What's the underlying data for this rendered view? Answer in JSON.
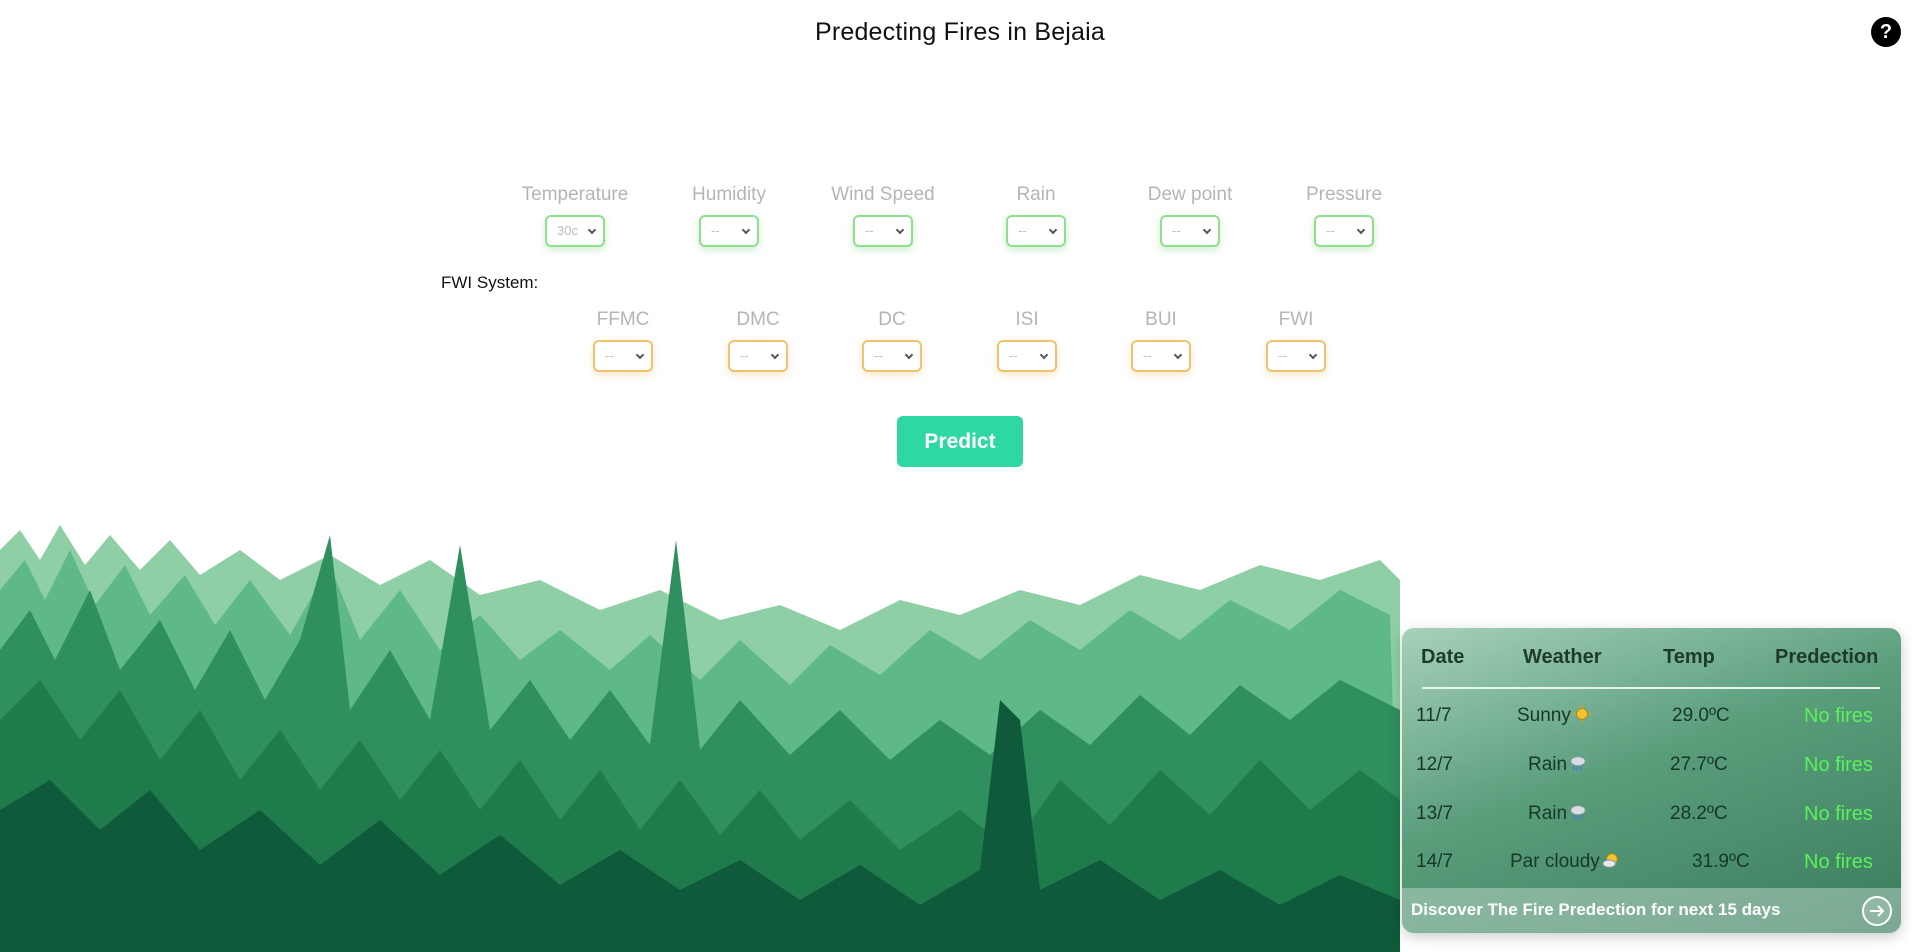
{
  "header": {
    "title": "Predecting Fires in Bejaia",
    "help_label": "?"
  },
  "weather_inputs": [
    {
      "label": "Temperature",
      "value": "30c"
    },
    {
      "label": "Humidity",
      "value": "--"
    },
    {
      "label": "Wind Speed",
      "value": "--"
    },
    {
      "label": "Rain",
      "value": "--"
    },
    {
      "label": "Dew point",
      "value": "--"
    },
    {
      "label": "Pressure",
      "value": "--"
    }
  ],
  "fwi": {
    "heading": "FWI System:",
    "inputs": [
      {
        "label": "FFMC",
        "value": "--"
      },
      {
        "label": "DMC",
        "value": "--"
      },
      {
        "label": "DC",
        "value": "--"
      },
      {
        "label": "ISI",
        "value": "--"
      },
      {
        "label": "BUI",
        "value": "--"
      },
      {
        "label": "FWI",
        "value": "--"
      }
    ]
  },
  "predict_label": "Predict",
  "forecast": {
    "headers": {
      "date": "Date",
      "weather": "Weather",
      "temp": "Temp",
      "prediction": "Predection"
    },
    "rows": [
      {
        "date": "11/7",
        "weather": "Sunny",
        "icon": "sun-icon",
        "temp": "29.0ºC",
        "prediction": "No fires"
      },
      {
        "date": "12/7",
        "weather": "Rain",
        "icon": "rain-cloud-icon",
        "temp": "27.7ºC",
        "prediction": "No fires"
      },
      {
        "date": "13/7",
        "weather": "Rain",
        "icon": "rain-cloud-icon",
        "temp": "28.2ºC",
        "prediction": "No fires"
      },
      {
        "date": "14/7",
        "weather": "Par cloudy",
        "icon": "partly-cloudy-icon",
        "temp": "31.9ºC",
        "prediction": "No fires"
      }
    ],
    "discover_label": "Discover The Fire Predection for next 15 days",
    "prediction_color": "#5af25a"
  },
  "colors": {
    "predict_button": "#2ed8a3",
    "weather_select_border": "#8de08d",
    "fwi_select_border": "#f1c36f",
    "forest_dark": "#0f5a3a",
    "forest_light": "#5fb887"
  }
}
